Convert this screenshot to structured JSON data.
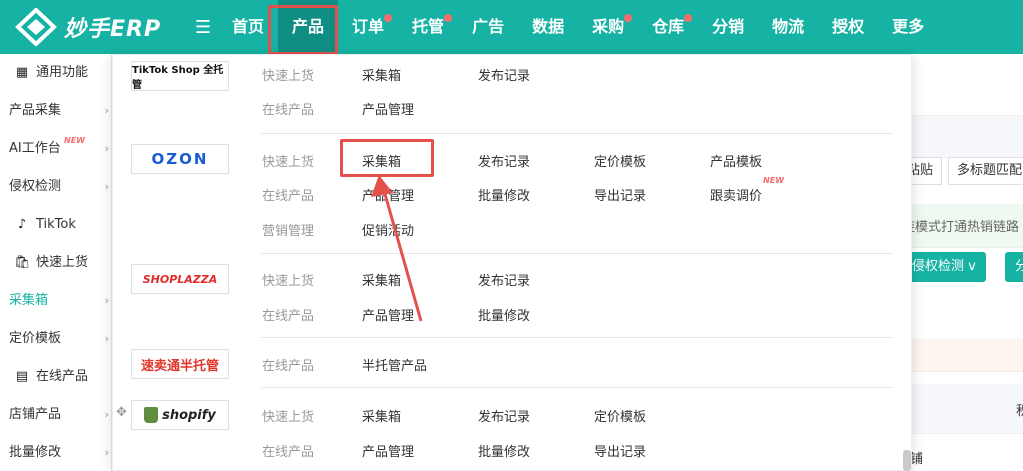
{
  "app": {
    "logo_text": "妙手ERP",
    "menu_icon": "hamburger-icon"
  },
  "colors": {
    "primary": "#16b3a4",
    "primary_dark": "#0f8f83",
    "highlight": "#e4514b",
    "badge": "#f56c6c"
  },
  "nav": [
    {
      "label": "首页",
      "dot": false
    },
    {
      "label": "产品",
      "dot": false,
      "active": true
    },
    {
      "label": "订单",
      "dot": true
    },
    {
      "label": "托管",
      "dot": true
    },
    {
      "label": "广告",
      "dot": false
    },
    {
      "label": "数据",
      "dot": false
    },
    {
      "label": "采购",
      "dot": true
    },
    {
      "label": "仓库",
      "dot": true
    },
    {
      "label": "分销",
      "dot": false
    },
    {
      "label": "物流",
      "dot": false
    },
    {
      "label": "授权",
      "dot": false
    },
    {
      "label": "更多",
      "dot": false
    }
  ],
  "sidebar": {
    "items": [
      {
        "label": "通用功能",
        "icon": "grid-icon"
      },
      {
        "label": "产品采集",
        "arrow": true
      },
      {
        "label": "AI工作台",
        "badge": "NEW",
        "arrow": true
      },
      {
        "label": "侵权检测",
        "arrow": true
      },
      {
        "label": "TikTok",
        "icon": "tiktok-icon"
      },
      {
        "label": "快速上货",
        "icon": "bag-icon"
      },
      {
        "label": "采集箱",
        "active": true,
        "arrow": true
      },
      {
        "label": "定价模板",
        "arrow": true
      },
      {
        "label": "在线产品",
        "icon": "store-icon"
      },
      {
        "label": "店铺产品",
        "arrow": true
      },
      {
        "label": "批量修改",
        "arrow": true
      }
    ]
  },
  "background": {
    "tab1": "粘贴",
    "tab2": "多标题匹配",
    "banner": "链模式打通热销链路",
    "btn1": "侵权检测",
    "btn1_caret": "v",
    "btn2": "分",
    "paren": ")",
    "col": "积",
    "row": "铺"
  },
  "dropdown": {
    "platforms": [
      {
        "name": "tiktok-shop",
        "logo_text": "TikTok Shop 全托管",
        "rows": [
          {
            "category": "快速上货",
            "links": [
              "采集箱",
              "发布记录"
            ]
          },
          {
            "category": "在线产品",
            "links": [
              "产品管理"
            ]
          }
        ]
      },
      {
        "name": "ozon",
        "logo_text": "OZON",
        "rows": [
          {
            "category": "快速上货",
            "links": [
              "采集箱",
              "发布记录",
              "定价模板",
              "产品模板"
            ]
          },
          {
            "category": "在线产品",
            "links": [
              "产品管理",
              "批量修改",
              "导出记录",
              "跟卖调价"
            ],
            "new_badge": "NEW"
          },
          {
            "category": "营销管理",
            "links": [
              "促销活动"
            ]
          }
        ]
      },
      {
        "name": "shoplazza",
        "logo_text": "SHOPLAZZA",
        "rows": [
          {
            "category": "快速上货",
            "links": [
              "采集箱",
              "发布记录"
            ]
          },
          {
            "category": "在线产品",
            "links": [
              "产品管理",
              "批量修改"
            ]
          }
        ]
      },
      {
        "name": "aliexpress-semi",
        "logo_text": "速卖通半托管",
        "rows": [
          {
            "category": "在线产品",
            "links": [
              "半托管产品"
            ]
          }
        ]
      },
      {
        "name": "shopify",
        "logo_text": "shopify",
        "rows": [
          {
            "category": "快速上货",
            "links": [
              "采集箱",
              "发布记录",
              "定价模板"
            ]
          },
          {
            "category": "在线产品",
            "links": [
              "产品管理",
              "批量修改",
              "导出记录"
            ]
          }
        ]
      }
    ]
  }
}
